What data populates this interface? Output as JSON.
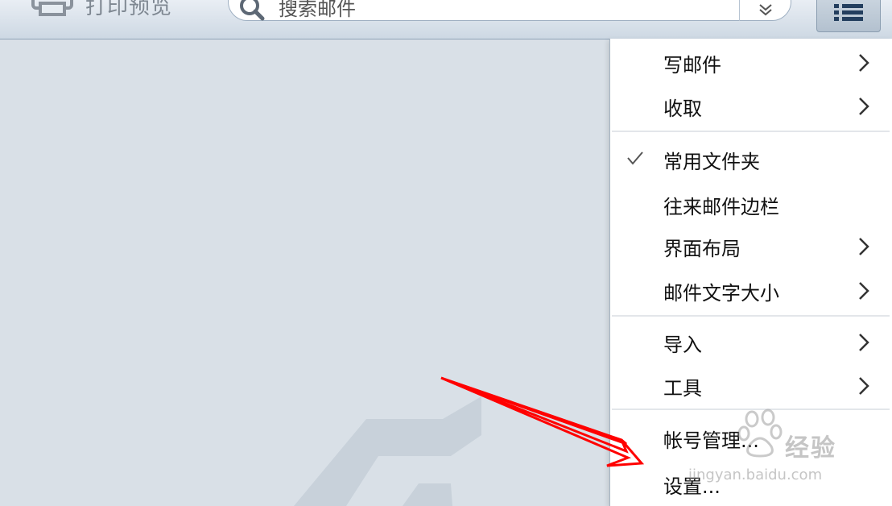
{
  "toolbar": {
    "print_label": "打印预览",
    "search_placeholder": "搜索邮件"
  },
  "menu": {
    "items": [
      {
        "label": "写邮件",
        "submenu": true,
        "checked": false
      },
      {
        "label": "收取",
        "submenu": true,
        "checked": false
      },
      {
        "label": "常用文件夹",
        "submenu": false,
        "checked": true
      },
      {
        "label": "往来邮件边栏",
        "submenu": false,
        "checked": false
      },
      {
        "label": "界面布局",
        "submenu": true,
        "checked": false
      },
      {
        "label": "邮件文字大小",
        "submenu": true,
        "checked": false
      },
      {
        "label": "导入",
        "submenu": true,
        "checked": false
      },
      {
        "label": "工具",
        "submenu": true,
        "checked": false
      },
      {
        "label": "帐号管理...",
        "submenu": false,
        "checked": false
      },
      {
        "label": "设置...",
        "submenu": false,
        "checked": false
      }
    ]
  },
  "watermark": {
    "brand": "经验",
    "url": "jingyan.baidu.com"
  },
  "colors": {
    "annotation_arrow": "#ff0000",
    "background": "#d9e0e7",
    "menu_background": "#ffffff"
  },
  "icons": {
    "print": "printer-icon",
    "search": "search-icon",
    "search_options": "double-chevron-down-icon",
    "menu": "list-menu-icon",
    "check": "check-icon",
    "submenu": "chevron-right-icon"
  }
}
